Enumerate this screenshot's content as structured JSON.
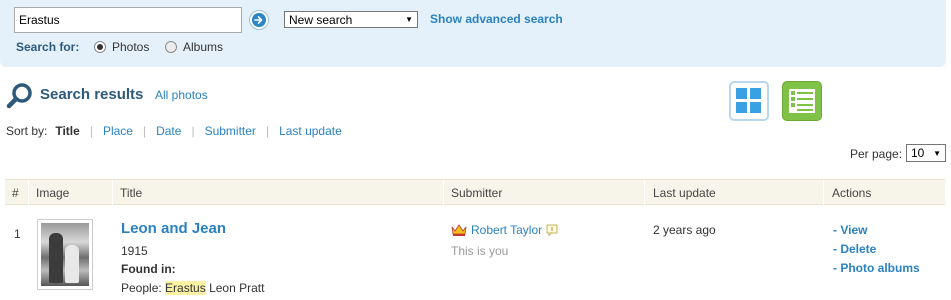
{
  "search": {
    "query": "Erastus",
    "mode_selected": "New search",
    "advanced_link": "Show advanced search",
    "search_for_label": "Search for:",
    "options": [
      {
        "label": "Photos",
        "checked": true
      },
      {
        "label": "Albums",
        "checked": false
      }
    ]
  },
  "results": {
    "title": "Search results",
    "all_photos_link": "All photos",
    "sort_label": "Sort by:",
    "sort_options": [
      {
        "label": "Title",
        "active": true
      },
      {
        "label": "Place",
        "active": false
      },
      {
        "label": "Date",
        "active": false
      },
      {
        "label": "Submitter",
        "active": false
      },
      {
        "label": "Last update",
        "active": false
      }
    ],
    "per_page_label": "Per page:",
    "per_page_value": "10"
  },
  "table": {
    "columns": [
      "#",
      "Image",
      "Title",
      "Submitter",
      "Last update",
      "Actions"
    ],
    "rows": [
      {
        "number": "1",
        "title": "Leon and Jean",
        "year": "1915",
        "found_in_label": "Found in:",
        "people_label": "People:",
        "people_highlight": "Erastus",
        "people_rest": "Leon Pratt",
        "submitter": "Robert Taylor",
        "submitter_note": "This is you",
        "last_update": "2 years ago",
        "actions": [
          "- View",
          "- Delete",
          "- Photo albums"
        ]
      }
    ]
  },
  "colors": {
    "panel_bg": "#e4f1fb",
    "link": "#2a82c0",
    "heading": "#2d5a7b",
    "list_view_active": "#80c148",
    "grid_view": "#3aa0e4",
    "table_header_bg": "#f7f5e9",
    "highlight": "#fbf2a4"
  },
  "icons": [
    "go-arrow-icon",
    "magnifier-icon",
    "grid-view-icon",
    "list-view-icon",
    "crown-icon",
    "message-icon",
    "dropdown-arrow-icon"
  ]
}
